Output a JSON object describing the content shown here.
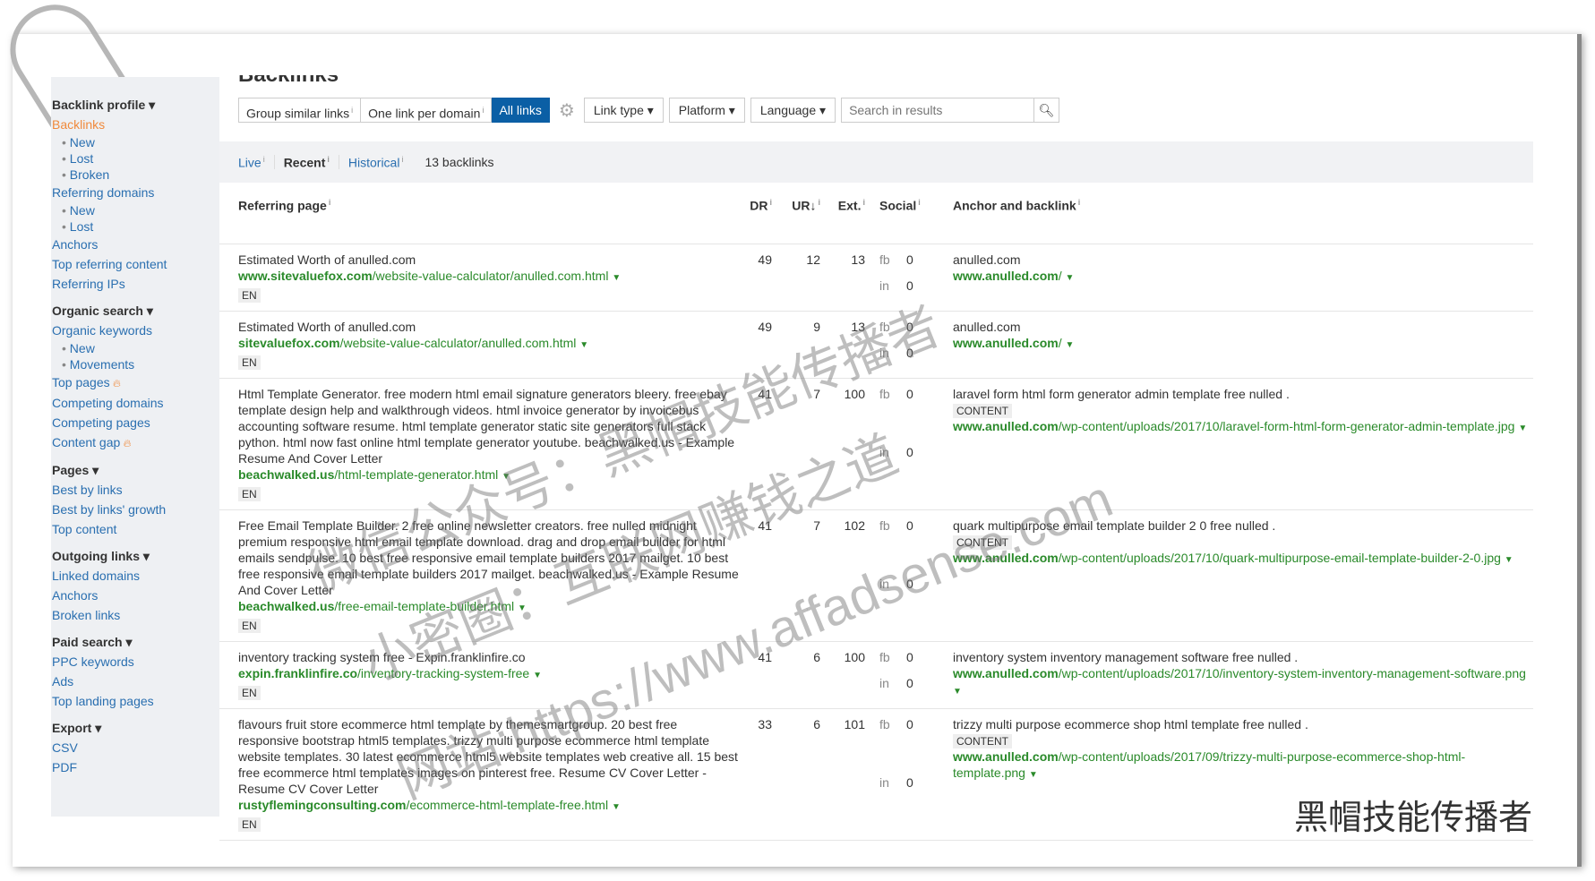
{
  "page": {
    "title": "Backlinks"
  },
  "sidebar": {
    "sections": [
      {
        "head": "Backlink profile ▾",
        "items": [
          {
            "label": "Backlinks",
            "active": true,
            "subs": [
              "New",
              "Lost",
              "Broken"
            ]
          },
          {
            "label": "Referring domains",
            "subs": [
              "New",
              "Lost"
            ]
          },
          {
            "label": "Anchors"
          },
          {
            "label": "Top referring content"
          },
          {
            "label": "Referring IPs"
          }
        ]
      },
      {
        "head": "Organic search ▾",
        "items": [
          {
            "label": "Organic keywords",
            "subs": [
              "New",
              "Movements"
            ]
          },
          {
            "label": "Top pages",
            "flame": true
          },
          {
            "label": "Competing domains"
          },
          {
            "label": "Competing pages"
          },
          {
            "label": "Content gap",
            "flame": true
          }
        ]
      },
      {
        "head": "Pages ▾",
        "items": [
          {
            "label": "Best by links"
          },
          {
            "label": "Best by links' growth"
          },
          {
            "label": "Top content"
          }
        ]
      },
      {
        "head": "Outgoing links ▾",
        "items": [
          {
            "label": "Linked domains"
          },
          {
            "label": "Anchors"
          },
          {
            "label": "Broken links"
          }
        ]
      },
      {
        "head": "Paid search ▾",
        "items": [
          {
            "label": "PPC keywords"
          },
          {
            "label": "Ads"
          },
          {
            "label": "Top landing pages"
          }
        ]
      },
      {
        "head": "Export ▾",
        "items": [
          {
            "label": "CSV"
          },
          {
            "label": "PDF"
          }
        ]
      }
    ]
  },
  "toolbar": {
    "group_similar": "Group similar links",
    "one_per_domain": "One link per domain",
    "all_links": "All links",
    "link_type": "Link type ▾",
    "platform": "Platform ▾",
    "language": "Language ▾",
    "search_placeholder": "Search in results"
  },
  "tabs": {
    "live": "Live",
    "recent": "Recent",
    "historical": "Historical",
    "count": "13 backlinks"
  },
  "table": {
    "headers": {
      "ref": "Referring page",
      "dr": "DR",
      "ur": "UR↓",
      "ext": "Ext.",
      "social": "Social",
      "anchor": "Anchor and backlink"
    },
    "rows": [
      {
        "title": "Estimated Worth of anulled.com",
        "domain": "www.sitevaluefox.com",
        "path": "/website-value-calculator/anulled.com.html",
        "lang": "EN",
        "dr": "49",
        "ur": "12",
        "ext": "13",
        "fb": "0",
        "in": "0",
        "anchor": "anulled.com",
        "content": "",
        "bdomain": "www.anulled.com",
        "bpath": "/"
      },
      {
        "title": "Estimated Worth of anulled.com",
        "domain": "sitevaluefox.com",
        "path": "/website-value-calculator/anulled.com.html",
        "lang": "EN",
        "dr": "49",
        "ur": "9",
        "ext": "13",
        "fb": "0",
        "in": "0",
        "anchor": "anulled.com",
        "content": "",
        "bdomain": "www.anulled.com",
        "bpath": "/"
      },
      {
        "title": "Html Template Generator. free modern html email signature generators bleery. free ebay template design help and walkthrough videos. html invoice generator by invoicebus accounting software resume. html template generator static site generators full stack python. html now fast online html template generator youtube. beachwalked.us - Example Resume And Cover Letter",
        "domain": "beachwalked.us",
        "path": "/html-template-generator.html",
        "lang": "EN",
        "dr": "41",
        "ur": "7",
        "ext": "100",
        "fb": "0",
        "in": "0",
        "anchor": "laravel form html form generator admin template free nulled .",
        "content": "CONTENT",
        "bdomain": "www.anulled.com",
        "bpath": "/wp-content/uploads/2017/10/laravel-form-html-form-generator-admin-template.jpg"
      },
      {
        "title": "Free Email Template Builder. 2 free online newsletter creators. free nulled midnight premium responsive html email template download. drag and drop email builder for html emails sendpulse. 10 best free responsive email template builders 2017 mailget. 10 best free responsive email template builders 2017 mailget. beachwalked.us - Example Resume And Cover Letter",
        "domain": "beachwalked.us",
        "path": "/free-email-template-builder.html",
        "lang": "EN",
        "dr": "41",
        "ur": "7",
        "ext": "102",
        "fb": "0",
        "in": "0",
        "anchor": "quark multipurpose email template builder 2 0 free nulled .",
        "content": "CONTENT",
        "bdomain": "www.anulled.com",
        "bpath": "/wp-content/uploads/2017/10/quark-multipurpose-email-template-builder-2-0.jpg"
      },
      {
        "title": "inventory tracking system free - Expin.franklinfire.co",
        "domain": "expin.franklinfire.co",
        "path": "/inventory-tracking-system-free",
        "lang": "EN",
        "dr": "41",
        "ur": "6",
        "ext": "100",
        "fb": "0",
        "in": "0",
        "anchor": "inventory system inventory management software free nulled .",
        "content": "",
        "bdomain": "www.anulled.com",
        "bpath": "/wp-content/uploads/2017/10/inventory-system-inventory-management-software.png"
      },
      {
        "title": "flavours fruit store ecommerce html template by themesmartgroup. 20 best free responsive bootstrap html5 templates. trizzy multi purpose ecommerce html template website templates. 30 latest ecommerce html5 website templates web creative all. 15 best free ecommerce html templates images on pinterest free. Resume CV Cover Letter - Resume CV Cover Letter",
        "domain": "rustyflemingconsulting.com",
        "path": "/ecommerce-html-template-free.html",
        "lang": "EN",
        "dr": "33",
        "ur": "6",
        "ext": "101",
        "fb": "0",
        "in": "0",
        "anchor": "trizzy multi purpose ecommerce shop html template free nulled .",
        "content": "CONTENT",
        "bdomain": "www.anulled.com",
        "bpath": "/wp-content/uploads/2017/09/trizzy-multi-purpose-ecommerce-shop-html-template.png"
      }
    ]
  },
  "watermark": {
    "line1": "微信公众号：黑帽技能传播者",
    "line2": "小密圈：互联网赚钱之道",
    "line3": "网站:https://www.affadsense.com",
    "brand": "黑帽技能传播者"
  }
}
